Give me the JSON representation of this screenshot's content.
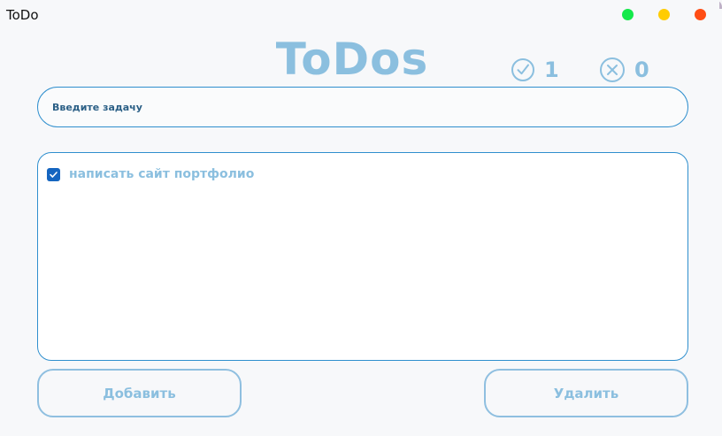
{
  "window": {
    "title": "ToDo",
    "controls": [
      {
        "name": "maximize",
        "color": "#14e94a"
      },
      {
        "name": "minimize",
        "color": "#ffcc00"
      },
      {
        "name": "close",
        "color": "#ff4d14"
      }
    ]
  },
  "header": {
    "title": "ToDos",
    "completed_count": "1",
    "failed_count": "0"
  },
  "input": {
    "placeholder": "Введите задачу",
    "value": ""
  },
  "tasks": [
    {
      "label": "написать сайт портфолио",
      "checked": true
    }
  ],
  "buttons": {
    "add_label": "Добавить",
    "delete_label": "Удалить"
  },
  "icons": {
    "completed": "check-circle-icon",
    "failed": "x-circle-icon",
    "task_check": "checkmark-icon"
  },
  "colors": {
    "accent": "#2f8fce",
    "title_text": "#8bbfdf",
    "button_text": "#8bbfdf",
    "checkbox_fill": "#1565c0",
    "background": "#f7f8fa"
  }
}
